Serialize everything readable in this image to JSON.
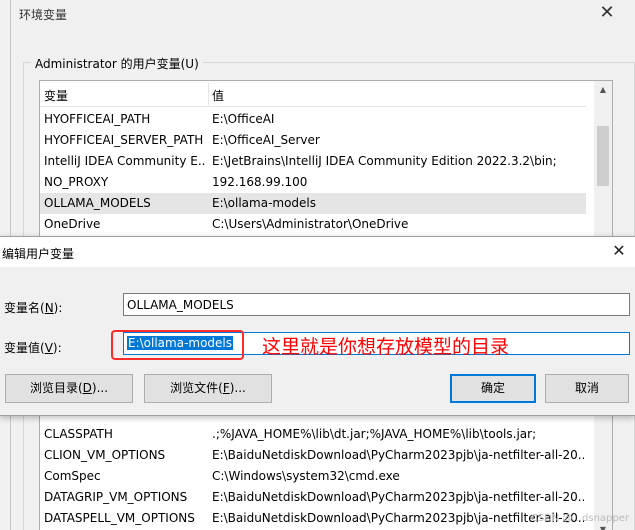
{
  "background_window": {
    "title": "环境变量",
    "close_glyph": "✕",
    "group_label": "Administrator 的用户变量(U)",
    "columns": [
      "变量",
      "值"
    ],
    "rows_top": [
      {
        "name": "HYOFFICEAI_PATH",
        "value": "E:\\OfficeAI"
      },
      {
        "name": "HYOFFICEAI_SERVER_PATH",
        "value": "E:\\OfficeAI_Server"
      },
      {
        "name": "IntelliJ IDEA Community E...",
        "value": "E:\\JetBrains\\IntelliJ IDEA Community Edition 2022.3.2\\bin;"
      },
      {
        "name": "NO_PROXY",
        "value": "192.168.99.100"
      },
      {
        "name": "OLLAMA_MODELS",
        "value": "E:\\ollama-models"
      },
      {
        "name": "OneDrive",
        "value": "C:\\Users\\Administrator\\OneDrive"
      }
    ],
    "rows_bottom": [
      {
        "name": "CLASSPATH",
        "value": ".;%JAVA_HOME%\\lib\\dt.jar;%JAVA_HOME%\\lib\\tools.jar;"
      },
      {
        "name": "CLION_VM_OPTIONS",
        "value": "E:\\BaiduNetdiskDownload\\PyCharm2023pjb\\ja-netfilter-all-20..."
      },
      {
        "name": "ComSpec",
        "value": "C:\\Windows\\system32\\cmd.exe"
      },
      {
        "name": "DATAGRIP_VM_OPTIONS",
        "value": "E:\\BaiduNetdiskDownload\\PyCharm2023pjb\\ja-netfilter-all-20..."
      },
      {
        "name": "DATASPELL_VM_OPTIONS",
        "value": "E:\\BaiduNetdiskDownload\\PyCharm2023pjb\\ja-netfilter-all-20..."
      }
    ]
  },
  "edit_dialog": {
    "title": "编辑用户变量",
    "close_glyph": "✕",
    "name_label": "变量名(N):",
    "name_value": "OLLAMA_MODELS",
    "value_label": "变量值(V):",
    "value_value": "E:\\ollama-models",
    "annotation": "这里就是你想存放模型的目录",
    "buttons": {
      "browse_dir": "浏览目录(D)...",
      "browse_file": "浏览文件(F)...",
      "ok": "确定",
      "cancel": "取消"
    }
  },
  "watermark": "CSDN @...dsnapper",
  "colors": {
    "selection": "#0078d7",
    "annotation": "#ff0000"
  }
}
